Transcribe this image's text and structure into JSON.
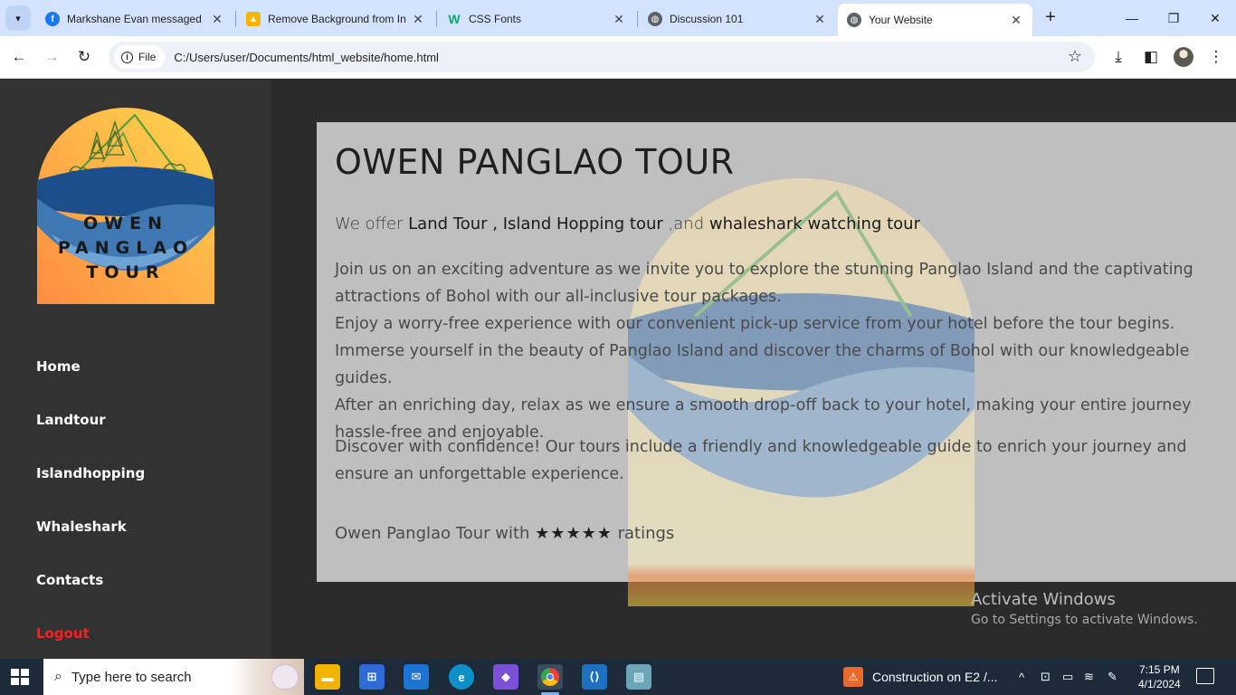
{
  "browser": {
    "tabs": [
      {
        "title": "Markshane Evan messaged y",
        "favicon": "facebook-icon",
        "color": "#1877f2",
        "active": false
      },
      {
        "title": "Remove Background from In",
        "favicon": "removebg-icon",
        "color": "#f5b400",
        "active": false
      },
      {
        "title": "CSS Fonts",
        "favicon": "w3schools-icon",
        "color": "#04aa6d",
        "active": false
      },
      {
        "title": "Discussion 101",
        "favicon": "globe-icon",
        "color": "#5f6368",
        "active": false
      },
      {
        "title": "Your Website",
        "favicon": "globe-icon",
        "color": "#5f6368",
        "active": true
      }
    ],
    "address": {
      "chip": "File",
      "url": "C:/Users/user/Documents/html_website/home.html"
    }
  },
  "sidebar": {
    "logo_lines": [
      "OWEN",
      "PANGLAO",
      "TOUR"
    ],
    "items": [
      {
        "label": "Home"
      },
      {
        "label": "Landtour"
      },
      {
        "label": "Islandhopping"
      },
      {
        "label": "Whaleshark"
      },
      {
        "label": "Contacts"
      },
      {
        "label": "Logout"
      }
    ]
  },
  "main": {
    "title": "OWEN PANGLAO TOUR",
    "offer_prefix": "We offer ",
    "offer_land": "Land Tour",
    "offer_sep1": " , ",
    "offer_island": "Island Hopping tour",
    "offer_sep2": " ,and ",
    "offer_whale": "whaleshark watching tour",
    "paragraphs": [
      "Join us on an exciting adventure as we invite you to explore the stunning Panglao Island and the captivating attractions of Bohol with our all-inclusive tour packages.",
      "Enjoy a worry-free experience with our convenient pick-up service from your hotel before the tour begins. Immerse yourself in the beauty of Panglao Island and discover the charms of Bohol with our knowledgeable guides.",
      "After an enriching day, relax as we ensure a smooth drop-off back to your hotel, making your entire journey hassle-free and enjoyable.",
      "Discover with confidence! Our tours include a friendly and knowledgeable guide to enrich your journey and ensure an unforgettable experience."
    ],
    "rating_prefix": "Owen Panglao Tour with ",
    "rating_stars": "★★★★★",
    "rating_suffix": " ratings"
  },
  "watermark": {
    "line1": "Activate Windows",
    "line2": "Go to Settings to activate Windows."
  },
  "taskbar": {
    "search_placeholder": "Type here to search",
    "notification": "Construction on E2 /...",
    "time": "7:15 PM",
    "date": "4/1/2024"
  },
  "colors": {
    "sidebar_bg": "#323232",
    "page_bg": "#2b2b2b",
    "card_bg": "#bfbfbf",
    "logout": "#ff2020",
    "logo_gradient_start": "#ff8c42",
    "logo_gradient_end": "#ffd84d"
  }
}
